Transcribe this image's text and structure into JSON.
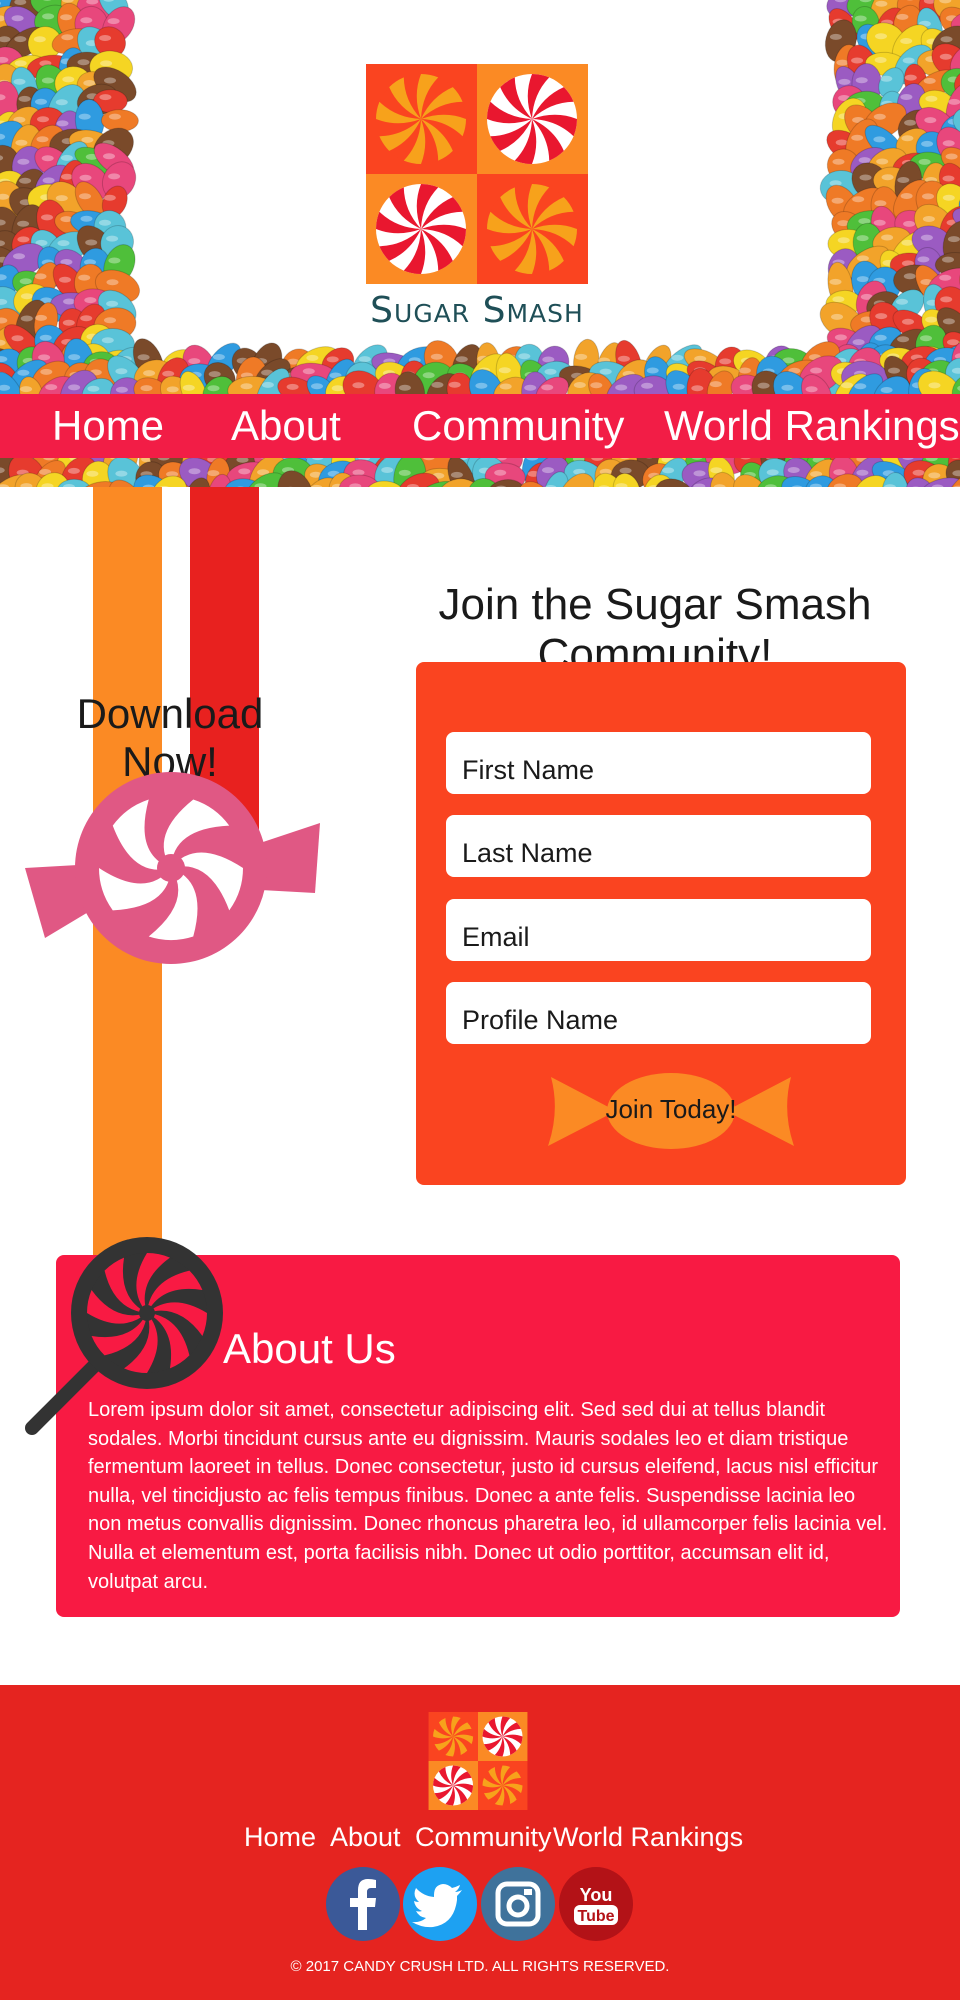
{
  "brand": {
    "name": "Sugar Smash"
  },
  "nav": {
    "items": [
      "Home",
      "About",
      "Community",
      "World Rankings"
    ]
  },
  "download": {
    "title": "Download Now!"
  },
  "join": {
    "title": "Join the Sugar Smash Community!",
    "fields": [
      {
        "placeholder": "First Name"
      },
      {
        "placeholder": "Last Name"
      },
      {
        "placeholder": "Email"
      },
      {
        "placeholder": "Profile Name"
      }
    ],
    "button_label": "Join Today!"
  },
  "about": {
    "title": "About Us",
    "body": "Lorem ipsum dolor sit amet, consectetur adipiscing elit. Sed sed dui at tellus blandit sodales. Morbi tincidunt cursus ante eu dignissim. Mauris sodales leo et diam tristique fermentum laoreet in tellus. Donec consectetur, justo id cursus eleifend, lacus nisl efficitur nulla, vel tincidjusto ac felis tempus finibus. Donec a ante felis. Suspendisse lacinia leo non metus convallis dignissim. Donec rhoncus pharetra leo, id ullamcorper felis lacinia vel. Nulla et elementum est, porta facilisis nibh. Donec ut odio porttitor, accumsan elit id, volutpat arcu."
  },
  "footer": {
    "links": [
      "Home",
      "About",
      "Community",
      "World Rankings"
    ],
    "social": [
      "facebook-icon",
      "twitter-icon",
      "instagram-icon",
      "youtube-icon"
    ],
    "youtube_text": [
      "You",
      "Tube"
    ],
    "copyright": "© 2017 CANDY CRUSH LTD. ALL RIGHTS RESERVED."
  },
  "colors": {
    "nav": "#f21d46",
    "orange": "#fb8a24",
    "red": "#e8211f",
    "form": "#fa4420",
    "about": "#f81a43",
    "footer": "#e52420",
    "brand_text": "#1f4f57"
  }
}
